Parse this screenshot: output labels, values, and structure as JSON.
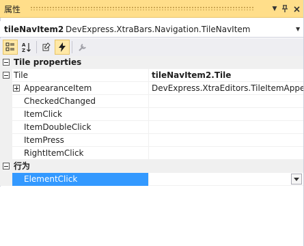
{
  "window": {
    "title": "属性",
    "buttons": {
      "dropdown": "▾",
      "pin": "ꟸ",
      "close": "✕"
    }
  },
  "object_selector": {
    "name": "tileNavItem2",
    "type": "DevExpress.XtraBars.Navigation.TileNavItem"
  },
  "toolbar": {
    "icons": [
      "categorized-icon",
      "alphabetical-icon",
      "properties-icon",
      "events-icon",
      "property-pages-icon"
    ],
    "active": "events-icon"
  },
  "grid": {
    "categories": [
      {
        "label": "Tile properties",
        "expanded": true,
        "rows": [
          {
            "name": "Tile",
            "value": "tileNavItem2.Tile",
            "expandable": true,
            "bold_value": true,
            "level": 0
          },
          {
            "name": "AppearanceItem",
            "value": "DevExpress.XtraEditors.TileItemAppea",
            "expandable": true,
            "bold_value": false,
            "level": 1
          },
          {
            "name": "CheckedChanged",
            "value": "",
            "level": 1
          },
          {
            "name": "ItemClick",
            "value": "",
            "level": 1
          },
          {
            "name": "ItemDoubleClick",
            "value": "",
            "level": 1
          },
          {
            "name": "ItemPress",
            "value": "",
            "level": 1
          },
          {
            "name": "RightItemClick",
            "value": "",
            "level": 1
          }
        ]
      },
      {
        "label": "行为",
        "expanded": true,
        "rows": [
          {
            "name": "ElementClick",
            "value": "",
            "selected": true
          }
        ]
      }
    ]
  },
  "colors": {
    "title_bg": "#ffde8a",
    "selection": "#3399ff",
    "category_bg": "#f0f0f0"
  }
}
